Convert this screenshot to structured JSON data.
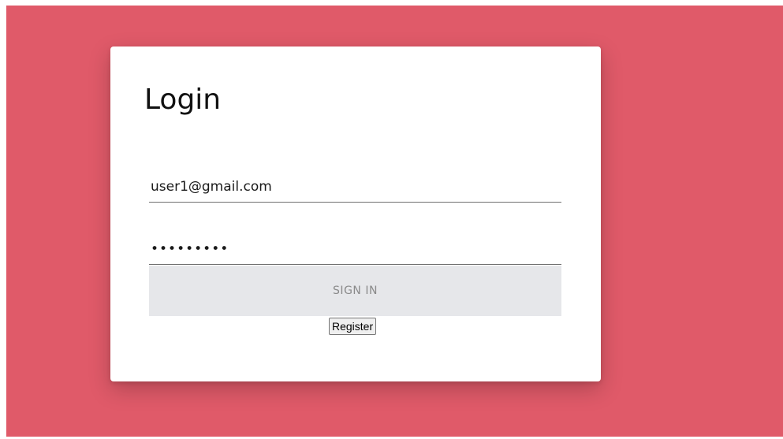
{
  "login": {
    "title": "Login",
    "email_value": "user1@gmail.com",
    "password_value": "•••••••••",
    "signin_label": "SIGN IN",
    "register_label": "Register"
  },
  "colors": {
    "background": "#e05a69",
    "card": "#ffffff",
    "signin_bg": "#e6e7ea"
  }
}
